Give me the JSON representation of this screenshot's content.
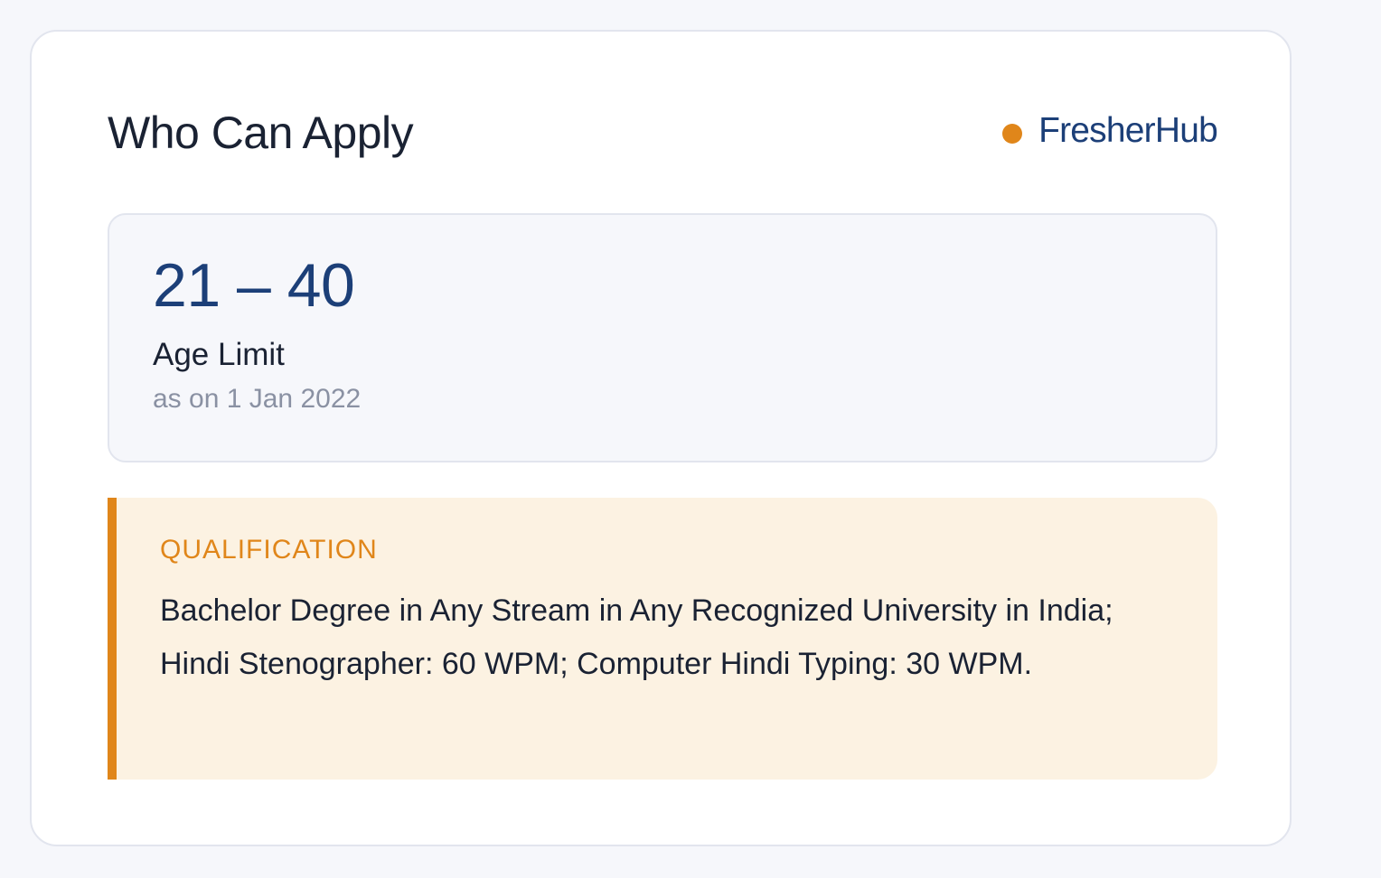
{
  "section": {
    "title": "Who Can Apply"
  },
  "brand": {
    "name": "FresherHub",
    "dot_color": "#e0861a",
    "name_color": "#1c3f78"
  },
  "age": {
    "value": "21 – 40",
    "label": "Age Limit",
    "note": "as on 1 Jan 2022"
  },
  "qualification": {
    "heading": "QUALIFICATION",
    "text": "Bachelor Degree in Any Stream in Any Recognized University in India; Hindi Stenographer: 60 WPM; Computer Hindi Typing: 30 WPM.",
    "accent_color": "#e0861a"
  }
}
